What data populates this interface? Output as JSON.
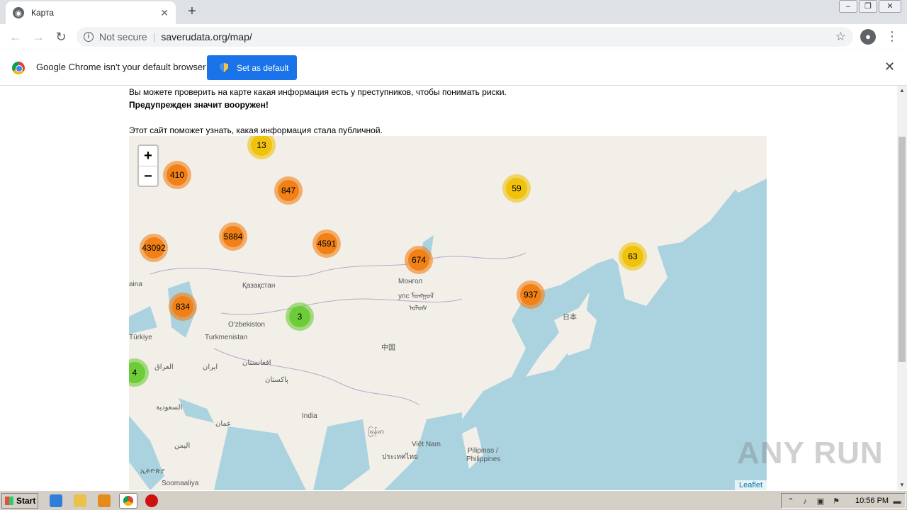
{
  "browser": {
    "tab_title": "Карта",
    "tab_favicon": "globe-icon",
    "url_security": "Not secure",
    "url": "saverudata.org/map/",
    "window_controls": [
      "minimize",
      "restore",
      "close"
    ]
  },
  "infobar": {
    "message": "Google Chrome isn't your default browser",
    "button_label": "Set as default"
  },
  "page": {
    "line1": "Вы можете проверить на карте какая информация есть у преступников, чтобы понимать риски.",
    "line2": "Предупрежден значит вооружен!",
    "line3": "Этот сайт поможет узнать, какая информация стала публичной."
  },
  "map": {
    "attribution": "Leaflet",
    "zoom_in": "+",
    "zoom_out": "−",
    "labels": [
      "Қазақстан",
      "O'zbekiston",
      "Turkmenistan",
      "Монгол",
      "улс ᠮᠣᠩᠭᠣᠯ",
      "ᠤᠯᠤᠰ",
      "中国",
      "日本",
      "India",
      "Việt Nam",
      "Pilipinas /",
      "Philippines",
      "ایران",
      "افغانستان",
      "پاکستان",
      "العراق",
      "السعودية",
      "عمان",
      "اليمن",
      "Soomaaliya",
      "ኢትዮጵያ",
      "Türkiye",
      "aina",
      "ประเทศไทย",
      "မြန်မာ"
    ],
    "clusters": [
      {
        "count": "13",
        "level": "medium"
      },
      {
        "count": "410",
        "level": "large"
      },
      {
        "count": "847",
        "level": "large"
      },
      {
        "count": "59",
        "level": "medium"
      },
      {
        "count": "5884",
        "level": "large"
      },
      {
        "count": "43092",
        "level": "large"
      },
      {
        "count": "4591",
        "level": "large"
      },
      {
        "count": "674",
        "level": "large"
      },
      {
        "count": "63",
        "level": "medium"
      },
      {
        "count": "937",
        "level": "large"
      },
      {
        "count": "834",
        "level": "large"
      },
      {
        "count": "3",
        "level": "small"
      },
      {
        "count": "4",
        "level": "small"
      }
    ],
    "colors": {
      "small": "#6ecc39",
      "medium": "#f0c20c",
      "large": "#f18017"
    }
  },
  "watermark": "ANY RUN",
  "taskbar": {
    "start_label": "Start",
    "clock": "10:56 PM"
  }
}
